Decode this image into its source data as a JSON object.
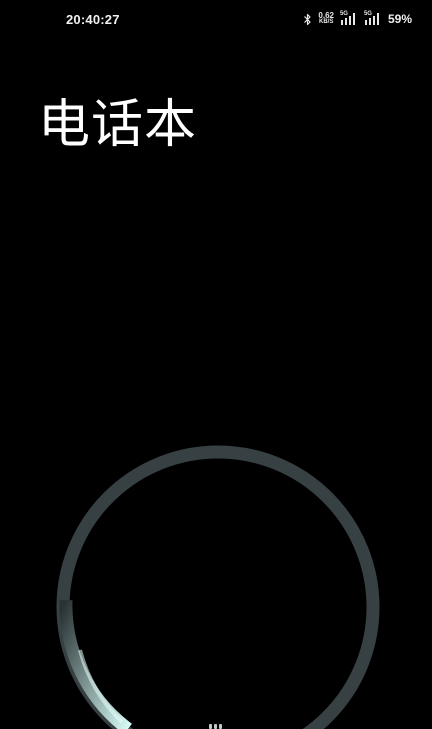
{
  "status_bar": {
    "time": "20:40:27",
    "bluetooth_icon": "bluetooth-icon",
    "net_speed_value": "0.62",
    "net_speed_unit": "KB/S",
    "sim1_tag": "5G",
    "sim2_tag": "5G",
    "battery": "59%"
  },
  "main": {
    "title": "电话本"
  },
  "dial_ring": {
    "icon": "circle-ring",
    "color_main": "#3a4345",
    "color_glow": "#c9f3ef"
  }
}
